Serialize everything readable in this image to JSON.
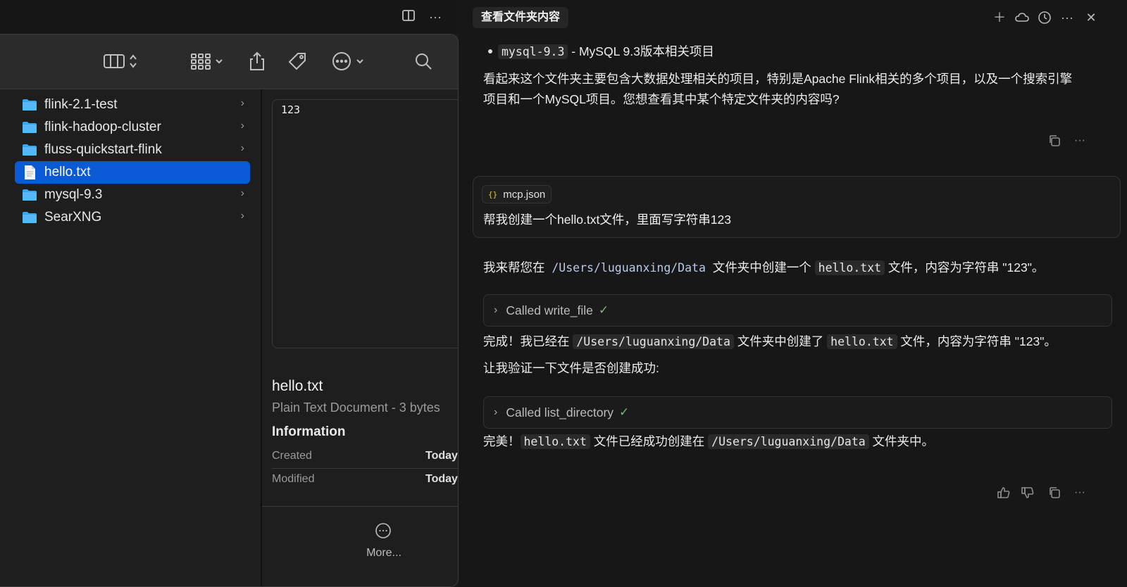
{
  "finder": {
    "files": [
      {
        "name": "flink-2.1-test",
        "type": "folder",
        "selected": false
      },
      {
        "name": "flink-hadoop-cluster",
        "type": "folder",
        "selected": false
      },
      {
        "name": "fluss-quickstart-flink",
        "type": "folder",
        "selected": false
      },
      {
        "name": "hello.txt",
        "type": "file",
        "selected": true
      },
      {
        "name": "mysql-9.3",
        "type": "folder",
        "selected": false
      },
      {
        "name": "SearXNG",
        "type": "folder",
        "selected": false
      }
    ],
    "preview": {
      "content": "123",
      "name": "hello.txt",
      "kind": "Plain Text Document - 3 bytes",
      "info_heading": "Information",
      "created_label": "Created",
      "created_value": "Today",
      "modified_label": "Modified",
      "modified_value": "Today",
      "more_label": "More..."
    }
  },
  "chat": {
    "title": "查看文件夹内容",
    "bullet_code": "mysql-9.3",
    "bullet_text": " - MySQL 9.3版本相关项目",
    "summary_line1": "看起来这个文件夹主要包含大数据处理相关的项目，特别是Apache Flink相关的多个项目，以及一个搜索引擎",
    "summary_line2": "项目和一个MySQL项目。您想查看其中某个特定文件夹的内容吗?",
    "user_attachment": "mcp.json",
    "user_message": "帮我创建一个hello.txt文件，里面写字符串123",
    "reply1_prefix": "我来帮您在 ",
    "reply1_path": "/Users/luguanxing/Data",
    "reply1_mid": " 文件夹中创建一个 ",
    "reply1_file": "hello.txt",
    "reply1_suffix": " 文件，内容为字符串 \"123\"。",
    "tool1": "Called write_file",
    "reply2_prefix": "完成！我已经在 ",
    "reply2_path": "/Users/luguanxing/Data",
    "reply2_mid": " 文件夹中创建了 ",
    "reply2_file": "hello.txt",
    "reply2_suffix": " 文件，内容为字符串 \"123\"。",
    "reply3": "让我验证一下文件是否创建成功:",
    "tool2": "Called list_directory",
    "reply4_prefix": "完美！",
    "reply4_file": "hello.txt",
    "reply4_mid": " 文件已经成功创建在 ",
    "reply4_path": "/Users/luguanxing/Data",
    "reply4_suffix": " 文件夹中。"
  }
}
